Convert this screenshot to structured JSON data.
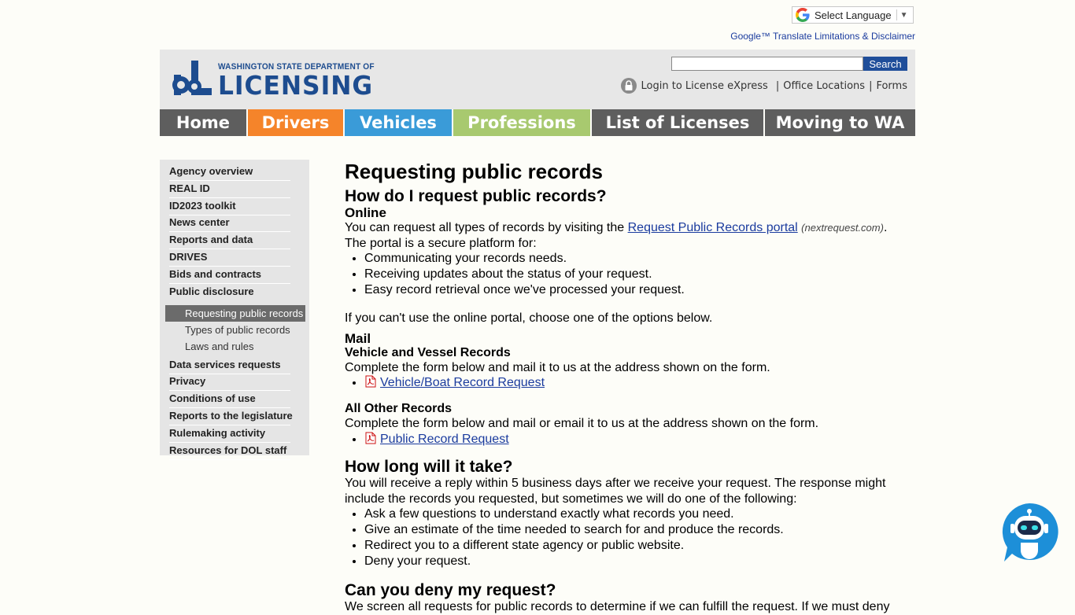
{
  "translate": {
    "select_label": "Select Language",
    "arrow": "▼",
    "disclaimer": "Google™ Translate Limitations & Disclaimer"
  },
  "header": {
    "agency_small": "WASHINGTON STATE DEPARTMENT OF",
    "agency_big": "LICENSING",
    "search_button": "Search",
    "search_placeholder": "",
    "util_links": {
      "login": "Login to License eXpress",
      "pipe": "|",
      "offices": "Office Locations",
      "forms": "Forms"
    }
  },
  "nav": [
    {
      "label": "Home",
      "color": "#5e5e5e"
    },
    {
      "label": "Drivers",
      "color": "#f5842a"
    },
    {
      "label": "Vehicles",
      "color": "#3a9bd8"
    },
    {
      "label": "Professions",
      "color": "#a8c96f"
    },
    {
      "label": "List of Licenses",
      "color": "#5e5e5e"
    },
    {
      "label": "Moving to WA",
      "color": "#5e5e5e"
    }
  ],
  "sidebar": {
    "items_top": [
      "Agency overview",
      "REAL ID",
      "ID2023 toolkit",
      "News center",
      "Reports and data",
      "DRIVES",
      "Bids and contracts",
      "Public disclosure"
    ],
    "sub_items": [
      "Requesting public records",
      "Types of public records",
      "Laws and rules"
    ],
    "items_bottom": [
      "Data services requests",
      "Privacy",
      "Conditions of use",
      "Reports to the legislature",
      "Rulemaking activity",
      "Resources for DOL staff"
    ]
  },
  "content": {
    "title": "Requesting public records",
    "h_how": "How do I request public records?",
    "h_online": "Online",
    "online_text_1": "You can request all types of records by visiting the ",
    "online_link": "Request Public Records portal",
    "online_domain": "(nextrequest.com)",
    "online_period": ".",
    "online_text_2": "The portal is a secure platform for:",
    "online_list": [
      "Communicating your records needs.",
      "Receiving updates about the status of your request.",
      "Easy record retrieval once we've processed your request."
    ],
    "cant_use": "If you can't use the online portal, choose one of the options below.",
    "h_mail": "Mail",
    "h_vehicle": "Vehicle and Vessel Records",
    "vehicle_text": "Complete the form below and mail it to us at the address shown on the form.",
    "vehicle_link": "Vehicle/Boat Record Request",
    "h_other": "All Other Records",
    "other_text": "Complete the form below and mail or email it to us at the address shown on the form.",
    "other_link": "Public Record Request",
    "h_long": "How long will it take?",
    "long_text": "You will receive a reply within 5 business days after we receive your request. The response might include the records you requested, but sometimes we will do one of the following:",
    "long_list": [
      "Ask a few questions to understand exactly what records you need.",
      "Give an estimate of the time needed to search for and produce the records.",
      "Redirect you to a different state agency or public website.",
      "Deny your request."
    ],
    "h_deny": "Can you deny my request?",
    "deny_text": "We screen all requests for public records to determine if we can fulfill the request. If we must deny"
  }
}
